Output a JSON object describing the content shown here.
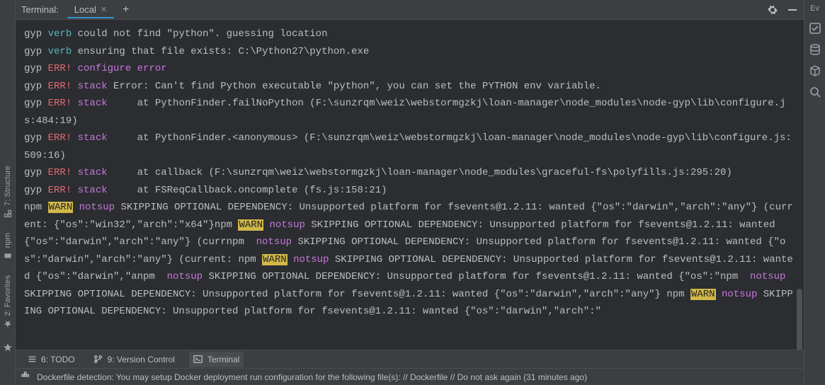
{
  "tabbar": {
    "title": "Terminal:",
    "tab_local": "Local",
    "add": "+"
  },
  "left_gutter": {
    "structure": "7: Structure",
    "npm": "npm",
    "favorites": "2: Favorites"
  },
  "right_gutter": {
    "ev_label": "Ev"
  },
  "terminal": {
    "tokens": [
      {
        "t": "gyp ",
        "c": ""
      },
      {
        "t": "verb ",
        "c": "tok-teal"
      },
      {
        "t": "could not find \"python\". guessing location",
        "c": ""
      },
      {
        "t": "\n",
        "c": ""
      },
      {
        "t": "gyp ",
        "c": ""
      },
      {
        "t": "verb ",
        "c": "tok-teal"
      },
      {
        "t": "ensuring that file exists: C:\\Python27\\python.exe",
        "c": ""
      },
      {
        "t": "\n",
        "c": ""
      },
      {
        "t": "gyp ",
        "c": ""
      },
      {
        "t": "ERR! ",
        "c": "tok-red"
      },
      {
        "t": "configure error",
        "c": "tok-purple"
      },
      {
        "t": "\n",
        "c": ""
      },
      {
        "t": "gyp ",
        "c": ""
      },
      {
        "t": "ERR! ",
        "c": "tok-red"
      },
      {
        "t": "stack ",
        "c": "tok-purple"
      },
      {
        "t": "Error: Can't find Python executable \"python\", you can set the PYTHON env variable.",
        "c": ""
      },
      {
        "t": "\n",
        "c": ""
      },
      {
        "t": "gyp ",
        "c": ""
      },
      {
        "t": "ERR! ",
        "c": "tok-red"
      },
      {
        "t": "stack ",
        "c": "tok-purple"
      },
      {
        "t": "    at PythonFinder.failNoPython (F:\\sunzrqm\\weiz\\webstormgzkj\\loan-manager\\node_modules\\node-gyp\\lib\\configure.js:484:19)",
        "c": ""
      },
      {
        "t": "\n",
        "c": ""
      },
      {
        "t": "gyp ",
        "c": ""
      },
      {
        "t": "ERR! ",
        "c": "tok-red"
      },
      {
        "t": "stack ",
        "c": "tok-purple"
      },
      {
        "t": "    at PythonFinder.<anonymous> (F:\\sunzrqm\\weiz\\webstormgzkj\\loan-manager\\node_modules\\node-gyp\\lib\\configure.js:509:16)",
        "c": ""
      },
      {
        "t": "\n",
        "c": ""
      },
      {
        "t": "gyp ",
        "c": ""
      },
      {
        "t": "ERR! ",
        "c": "tok-red"
      },
      {
        "t": "stack ",
        "c": "tok-purple"
      },
      {
        "t": "    at callback (F:\\sunzrqm\\weiz\\webstormgzkj\\loan-manager\\node_modules\\graceful-fs\\polyfills.js:295:20)",
        "c": ""
      },
      {
        "t": "\n",
        "c": ""
      },
      {
        "t": "gyp ",
        "c": ""
      },
      {
        "t": "ERR! ",
        "c": "tok-red"
      },
      {
        "t": "stack ",
        "c": "tok-purple"
      },
      {
        "t": "    at FSReqCallback.oncomplete (fs.js:158:21)",
        "c": ""
      },
      {
        "t": "\n",
        "c": ""
      },
      {
        "t": "npm ",
        "c": ""
      },
      {
        "t": "WARN",
        "c": "tok-warn"
      },
      {
        "t": " notsup ",
        "c": "tok-purple"
      },
      {
        "t": "SKIPPING OPTIONAL DEPENDENCY: Unsupported platform for fsevents@1.2.11: wanted {\"os\":\"darwin\",\"arch\":\"any\"} (current: {\"os\":\"win32\",\"arch\":\"x64\"}npm ",
        "c": ""
      },
      {
        "t": "WARN",
        "c": "tok-warn"
      },
      {
        "t": " notsup ",
        "c": "tok-purple"
      },
      {
        "t": "SKIPPING OPTIONAL DEPENDENCY: Unsupported platform for fsevents@1.2.11: wanted {\"os\":\"darwin\",\"arch\":\"any\"} (currnpm  ",
        "c": ""
      },
      {
        "t": "notsup ",
        "c": "tok-purple"
      },
      {
        "t": "SKIPPING OPTIONAL DEPENDENCY: Unsupported platform for fsevents@1.2.11: wanted {\"os\":\"darwin\",\"arch\":\"any\"} (current: npm ",
        "c": ""
      },
      {
        "t": "WARN",
        "c": "tok-warn"
      },
      {
        "t": " notsup ",
        "c": "tok-purple"
      },
      {
        "t": "SKIPPING OPTIONAL DEPENDENCY: Unsupported platform for fsevents@1.2.11: wanted {\"os\":\"darwin\",\"anpm  ",
        "c": ""
      },
      {
        "t": "notsup ",
        "c": "tok-purple"
      },
      {
        "t": "SKIPPING OPTIONAL DEPENDENCY: Unsupported platform for fsevents@1.2.11: wanted {\"os\":\"npm  ",
        "c": ""
      },
      {
        "t": "notsup ",
        "c": "tok-purple"
      },
      {
        "t": "SKIPPING OPTIONAL DEPENDENCY: Unsupported platform for fsevents@1.2.11: wanted {\"os\":\"darwin\",\"arch\":\"any\"} npm ",
        "c": ""
      },
      {
        "t": "WARN",
        "c": "tok-warn"
      },
      {
        "t": " notsup ",
        "c": "tok-purple"
      },
      {
        "t": "SKIPPING OPTIONAL DEPENDENCY: Unsupported platform for fsevents@1.2.11: wanted {\"os\":\"darwin\",\"arch\":\"",
        "c": ""
      }
    ]
  },
  "bottom_tabs": {
    "todo": "6: TODO",
    "vcs": "9: Version Control",
    "terminal": "Terminal"
  },
  "status": {
    "message": "Dockerfile detection: You may setup Docker deployment run configuration for the following file(s): // Dockerfile // Do not ask again (31 minutes ago)"
  }
}
